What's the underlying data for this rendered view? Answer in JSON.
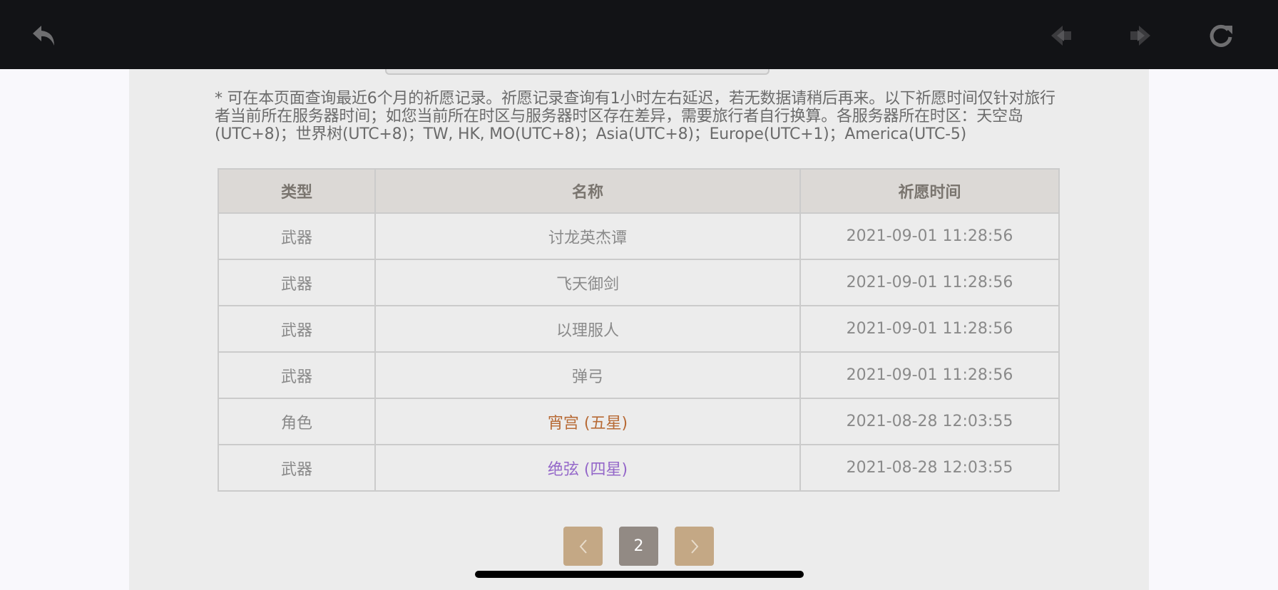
{
  "notice": "* 可在本页面查询最近6个月的祈愿记录。祈愿记录查询有1小时左右延迟，若无数据请稍后再来。以下祈愿时间仅针对旅行者当前所在服务器时间；如您当前所在时区与服务器时区存在差异，需要旅行者自行换算。各服务器所在时区：天空岛(UTC+8)；世界树(UTC+8)；TW, HK, MO(UTC+8)；Asia(UTC+8)；Europe(UTC+1)；America(UTC-5)",
  "table": {
    "headers": [
      "类型",
      "名称",
      "祈愿时间"
    ],
    "rows": [
      {
        "type": "武器",
        "name": "讨龙英杰谭",
        "time": "2021-09-01 11:28:56"
      },
      {
        "type": "武器",
        "name": "飞天御剑",
        "time": "2021-09-01 11:28:56"
      },
      {
        "type": "武器",
        "name": "以理服人",
        "time": "2021-09-01 11:28:56"
      },
      {
        "type": "武器",
        "name": "弹弓",
        "time": "2021-09-01 11:28:56"
      },
      {
        "type": "角色",
        "name": "宵宫 (五星)",
        "time": "2021-08-28 12:03:55"
      },
      {
        "type": "武器",
        "name": "绝弦 (四星)",
        "time": "2021-08-28 12:03:55"
      }
    ]
  },
  "pagination": {
    "current_page": "2",
    "prev_glyph": "‹",
    "next_glyph": "›"
  },
  "colors": {
    "five_star": "#b76a35",
    "four_star": "#9467c9",
    "page_button": "#c4a885",
    "page_current": "#928a84"
  },
  "icons": {
    "back": "undo-arrow-icon",
    "prev": "nav-prev-icon",
    "next": "nav-next-icon",
    "refresh": "refresh-icon"
  }
}
